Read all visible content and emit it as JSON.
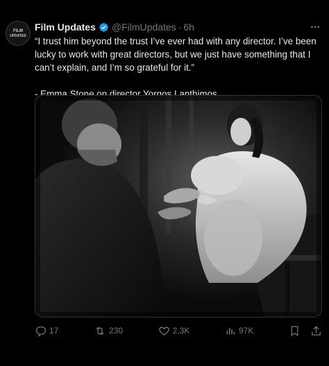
{
  "author": {
    "name": "Film Updates",
    "handle": "@FilmUpdates",
    "separator": "·",
    "time": "6h",
    "avatar_text_top": "FILM",
    "avatar_text_bottom": "UPDATES"
  },
  "body": {
    "quote": "“I trust him beyond the trust I’ve ever had with any director. I’ve been lucky to work with great directors, but we just have something that I can’t explain, and I’m so grateful for it.”",
    "attribution": "- Emma Stone on director Yorgos Lanthimos"
  },
  "actions": {
    "replies": "17",
    "reposts": "230",
    "likes": "2.3K",
    "views": "97K"
  },
  "colors": {
    "background": "#000000",
    "text": "#e7e9ea",
    "muted": "#71767b",
    "verified": "#1d9bf0"
  },
  "icons": {
    "more": "more-icon",
    "verified": "verified-badge-icon",
    "reply": "reply-icon",
    "repost": "repost-icon",
    "like": "like-icon",
    "views": "views-icon",
    "bookmark": "bookmark-icon",
    "share": "share-icon"
  }
}
